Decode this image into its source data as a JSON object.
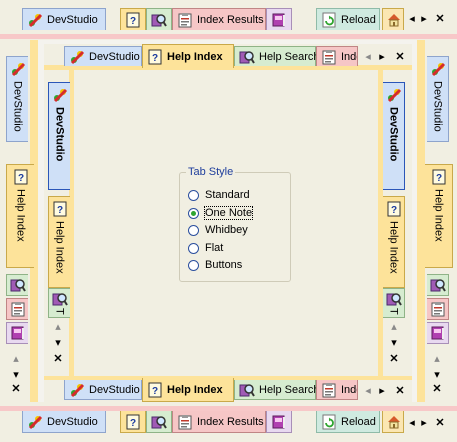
{
  "icons": {
    "devstudio": "devstudio-icon",
    "help": "question-mark-icon",
    "search": "magnifier-book-icon",
    "results": "clipboard-icon",
    "reload": "refresh-icon",
    "home": "home-icon",
    "book": "book-icon"
  },
  "top_bar": {
    "tabs": [
      "DevStudio",
      "",
      "",
      "Index Results",
      "",
      "Reload",
      ""
    ],
    "controls": [
      "◂",
      "▸",
      "✕"
    ]
  },
  "bottom_bar": {
    "tabs": [
      "DevStudio",
      "",
      "",
      "Index Results",
      "",
      "Reload",
      ""
    ],
    "controls": [
      "◂",
      "▸",
      "✕"
    ]
  },
  "inner_top_bar": {
    "tabs": [
      "DevStudio",
      "Help Index",
      "Help Search",
      "Inde"
    ],
    "controls": [
      "◂",
      "▸",
      "✕"
    ]
  },
  "inner_bottom_bar": {
    "tabs": [
      "DevStudio",
      "Help Index",
      "Help Search",
      "Inde"
    ],
    "controls": [
      "◂",
      "▸",
      "✕"
    ]
  },
  "left_outer": {
    "tabs": [
      "DevStudio",
      "Help Index"
    ],
    "controls": [
      "▴",
      "▾",
      "✕"
    ]
  },
  "left_inner": {
    "tabs": [
      "DevStudio",
      "Help Index",
      "T"
    ],
    "controls": [
      "▴",
      "▾",
      "✕"
    ]
  },
  "right_inner": {
    "tabs": [
      "DevStudio",
      "Help Index",
      "T"
    ],
    "controls": [
      "▴",
      "▾",
      "✕"
    ]
  },
  "right_outer": {
    "tabs": [
      "DevStudio",
      "Help Index"
    ],
    "controls": [
      "▴",
      "▾",
      "✕"
    ]
  },
  "tab_style": {
    "legend": "Tab Style",
    "options": [
      "Standard",
      "One Note",
      "Whidbey",
      "Flat",
      "Buttons"
    ],
    "selected": "One Note"
  },
  "colors": {
    "devstudio_tab": "#cfe0f7",
    "help_tab": "#fde39a",
    "search_tab": "#d6ecd0",
    "results_tab": "#f6c6c6",
    "reload_tab": "#cfeae0",
    "active_border": "#2b56b8"
  }
}
